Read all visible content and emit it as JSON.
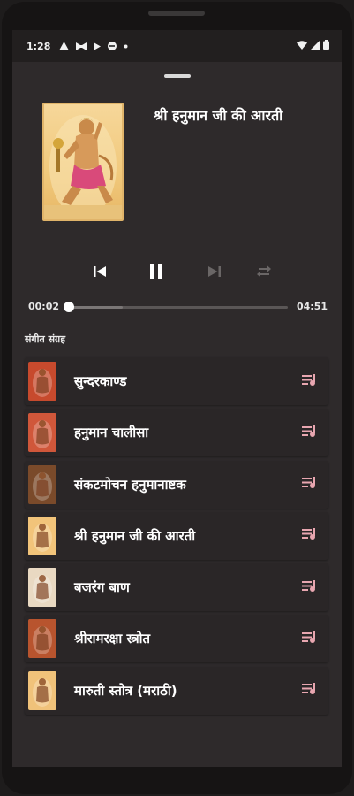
{
  "status_bar": {
    "time": "1:28",
    "icons": [
      "warning-icon",
      "bowtie-icon",
      "play-icon",
      "dnd-icon",
      "dot-icon"
    ],
    "right_icons": [
      "wifi-icon",
      "signal-icon",
      "battery-icon"
    ]
  },
  "now_playing": {
    "title": "श्री हनुमान जी की आरती",
    "elapsed": "00:02",
    "duration": "04:51",
    "progress": 0.007,
    "buffered": 0.25
  },
  "controls": {
    "previous_icon": "skip-previous-icon",
    "pause_icon": "pause-icon",
    "next_icon": "skip-next-icon",
    "repeat_icon": "repeat-icon"
  },
  "playlist": {
    "title": "संगीत संग्रह",
    "items": [
      {
        "label": "सुन्दरकाण्ड",
        "thumb": "#c74a2d"
      },
      {
        "label": "हनुमान चालीसा",
        "thumb": "#d0573a"
      },
      {
        "label": "संकटमोचन हनुमानाष्टक",
        "thumb": "#7a4a2a"
      },
      {
        "label": "श्री हनुमान जी की आरती",
        "thumb": "#f2c47a"
      },
      {
        "label": "बजरंग बाण",
        "thumb": "#e9d9c2"
      },
      {
        "label": "श्रीरामरक्षा स्त्रोत",
        "thumb": "#b8542e"
      },
      {
        "label": "मारुती स्तोत्र (मराठी)",
        "thumb": "#f0c27a"
      }
    ],
    "queue_icon": "playlist-add-icon",
    "accent": "#e8a6b0"
  }
}
